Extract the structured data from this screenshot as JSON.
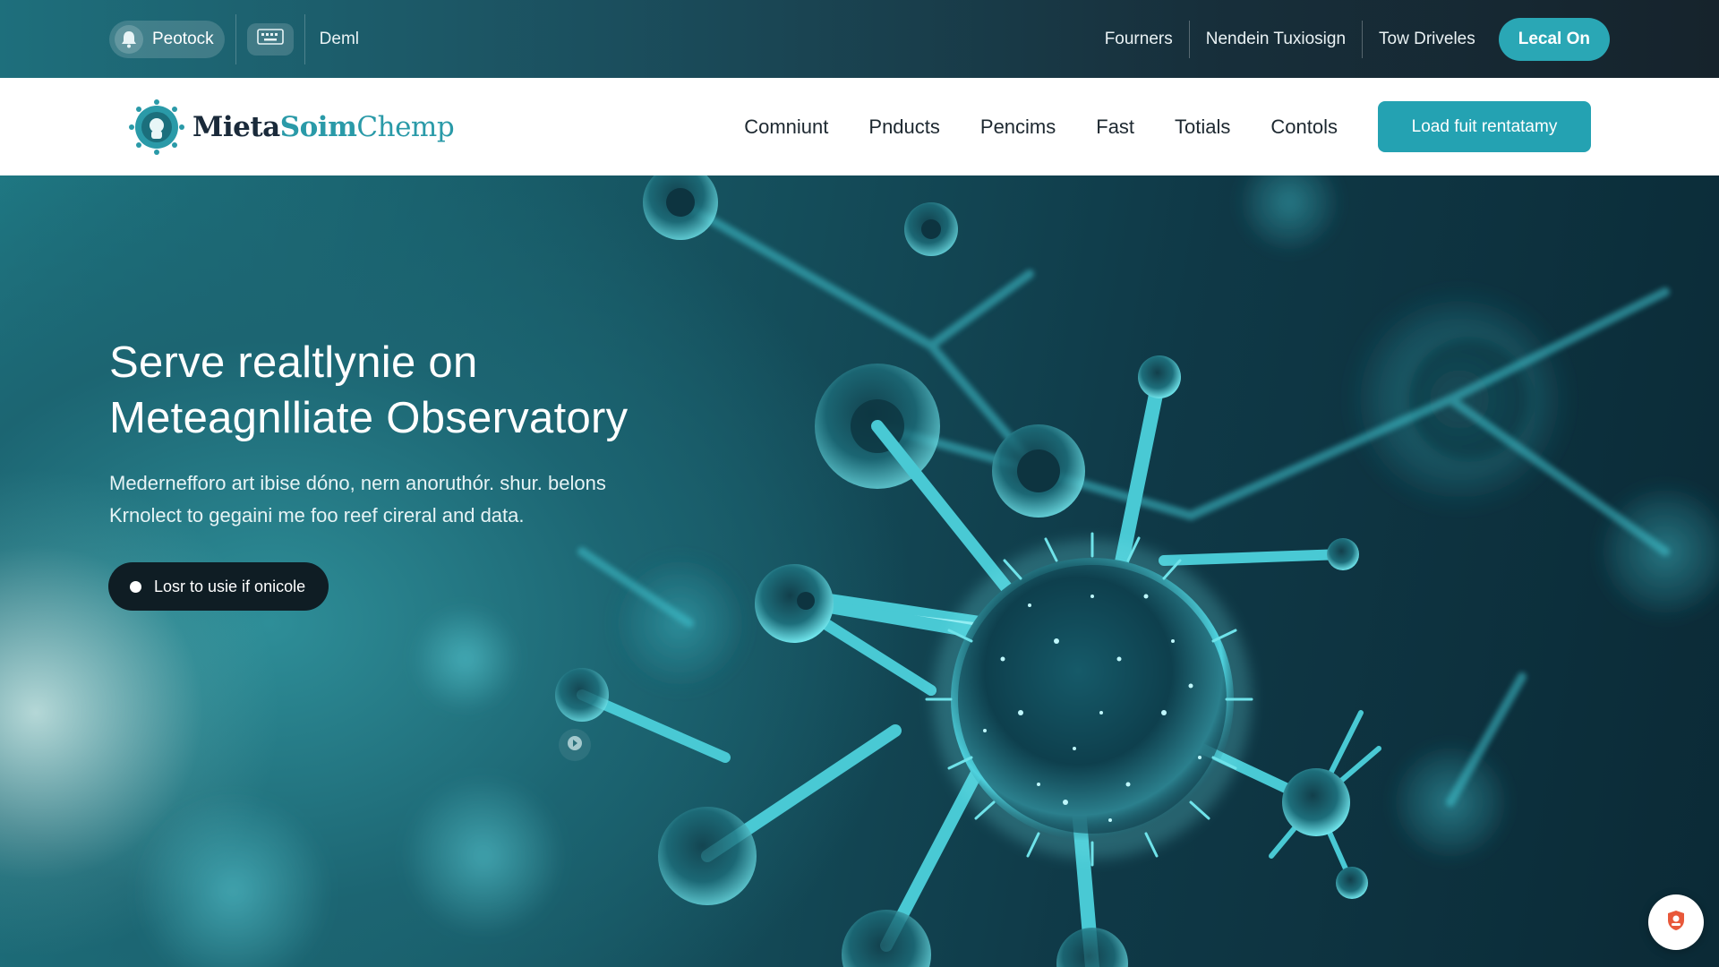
{
  "topbar": {
    "pill_label": "Peotock",
    "pill_icon": "bell-icon",
    "square_icon": "keyboard-icon",
    "demo_label": "Deml",
    "links": [
      {
        "label": "Fourners"
      },
      {
        "label": "Nendein Tuxiosign"
      },
      {
        "label": "Tow Driveles"
      }
    ],
    "locate_label": "Lecal On"
  },
  "nav": {
    "logo": {
      "part1": "Mieta",
      "part2": "Soim",
      "part3": "Chemp"
    },
    "links": [
      {
        "label": "Comniunt"
      },
      {
        "label": "Pnducts"
      },
      {
        "label": "Pencims"
      },
      {
        "label": "Fast"
      },
      {
        "label": "Totials"
      },
      {
        "label": "Contols"
      }
    ],
    "cta_label": "Load fuit rentatamy"
  },
  "hero": {
    "title_line1": "Serve realtlynie on",
    "title_line2": "Meteagnlliate Observatory",
    "sub_line1": "Medernefforo art ibise dóno, nern anoruthór. shur. belons",
    "sub_line2": "Krnolect to gegaini me foo reef cireral and data.",
    "button_label": "Losr to usie if onicole"
  },
  "colors": {
    "accent": "#24a2b2",
    "topbar_dark": "#16232c",
    "hero_teal": "#1c6572",
    "dark_button": "#0f1d24",
    "help_orange": "#e8583a"
  }
}
